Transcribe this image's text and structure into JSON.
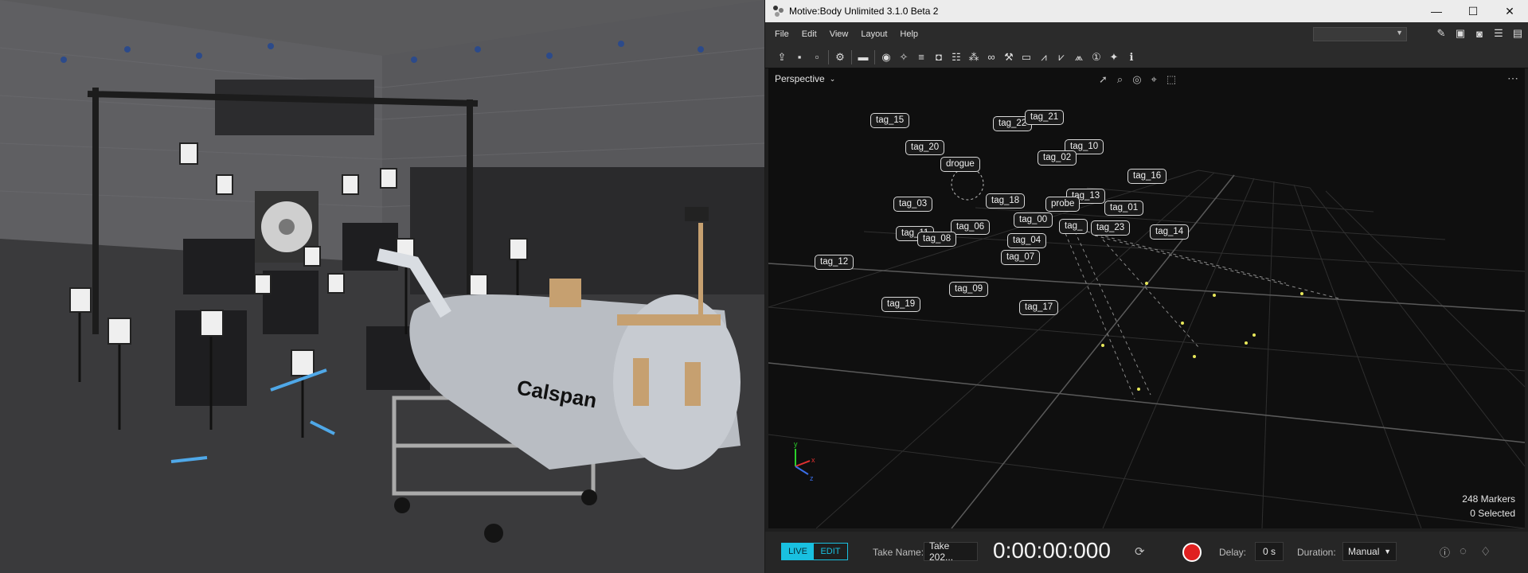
{
  "app": {
    "title": "Motive:Body Unlimited 3.1.0 Beta 2",
    "menu": [
      "File",
      "Edit",
      "View",
      "Layout",
      "Help"
    ],
    "layout_dropdown": ""
  },
  "window_controls": {
    "minimize": "—",
    "maximize": "☐",
    "close": "✕"
  },
  "toolbar_icons": [
    "new-take-icon",
    "save-icon",
    "save-all-icon",
    "settings-icon",
    "panel-icon",
    "camera-icon",
    "wand-icon",
    "database-icon",
    "calibration-icon",
    "list-icon",
    "asset-icon",
    "link-icon",
    "tools-icon",
    "tag-icon",
    "graph-icon",
    "graph-2-icon",
    "graph-3-icon",
    "one-badge-icon",
    "marker-icon",
    "info-icon"
  ],
  "viewport": {
    "mode_label": "Perspective",
    "tags": [
      {
        "id": "tag_15",
        "label": "tag_15"
      },
      {
        "id": "tag_22",
        "label": "tag_22"
      },
      {
        "id": "tag_21",
        "label": "tag_21"
      },
      {
        "id": "tag_20",
        "label": "tag_20"
      },
      {
        "id": "tag_10",
        "label": "tag_10"
      },
      {
        "id": "tag_02",
        "label": "tag_02"
      },
      {
        "id": "drogue",
        "label": "drogue"
      },
      {
        "id": "tag_16",
        "label": "tag_16"
      },
      {
        "id": "tag_13",
        "label": "tag_13"
      },
      {
        "id": "tag_18",
        "label": "tag_18"
      },
      {
        "id": "tag_03",
        "label": "tag_03"
      },
      {
        "id": "probe",
        "label": "probe"
      },
      {
        "id": "tag_01",
        "label": "tag_01"
      },
      {
        "id": "tag_00",
        "label": "tag_00"
      },
      {
        "id": "tag_06",
        "label": "tag_06"
      },
      {
        "id": "tag_partial",
        "label": "tag_"
      },
      {
        "id": "tag_23",
        "label": "tag_23"
      },
      {
        "id": "tag_14",
        "label": "tag_14"
      },
      {
        "id": "tag_11",
        "label": "tag_11"
      },
      {
        "id": "tag_08",
        "label": "tag_08"
      },
      {
        "id": "tag_04",
        "label": "tag_04"
      },
      {
        "id": "tag_07",
        "label": "tag_07"
      },
      {
        "id": "tag_12",
        "label": "tag_12"
      },
      {
        "id": "tag_09",
        "label": "tag_09"
      },
      {
        "id": "tag_19",
        "label": "tag_19"
      },
      {
        "id": "tag_17",
        "label": "tag_17"
      }
    ],
    "markers_text": "248 Markers",
    "selected_text": "0 Selected"
  },
  "bottom": {
    "live_label": "LIVE",
    "edit_label": "EDIT",
    "take_name_label": "Take Name:",
    "take_name_value": "Take 202...",
    "timecode": "0:00:00:000",
    "delay_label": "Delay:",
    "delay_value": "0 s",
    "duration_label": "Duration:",
    "duration_value": "Manual"
  },
  "photo": {
    "brand_text": "Calspan"
  },
  "colors": {
    "accent": "#19c0e0",
    "record": "#e02020",
    "viewport_bg": "#0f0f0f"
  }
}
